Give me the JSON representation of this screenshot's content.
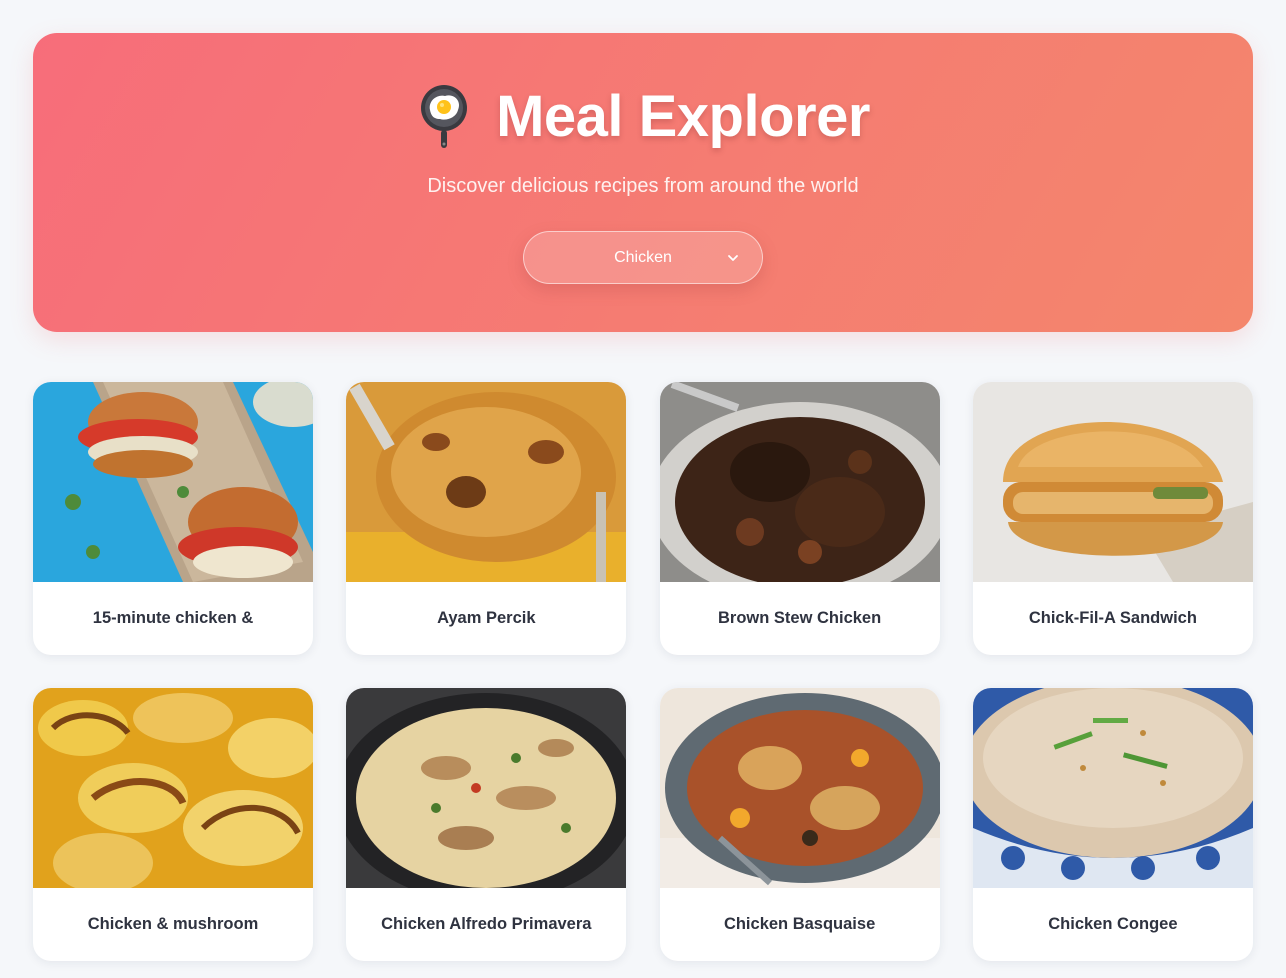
{
  "header": {
    "icon": "frying-pan-egg-icon",
    "title": "Meal Explorer",
    "subtitle": "Discover delicious recipes from around the world",
    "category_select": {
      "value": "Chicken",
      "icon": "chevron-down-icon"
    }
  },
  "meals": [
    {
      "title": "15-minute chicken &"
    },
    {
      "title": "Ayam Percik"
    },
    {
      "title": "Brown Stew Chicken"
    },
    {
      "title": "Chick-Fil-A Sandwich"
    },
    {
      "title": "Chicken & mushroom"
    },
    {
      "title": "Chicken Alfredo Primavera"
    },
    {
      "title": "Chicken Basquaise"
    },
    {
      "title": "Chicken Congee"
    }
  ],
  "colors": {
    "hero_start": "#f76d7a",
    "hero_end": "#f4866c",
    "card_title": "#2f3340",
    "page_bg": "#f5f7fa"
  }
}
